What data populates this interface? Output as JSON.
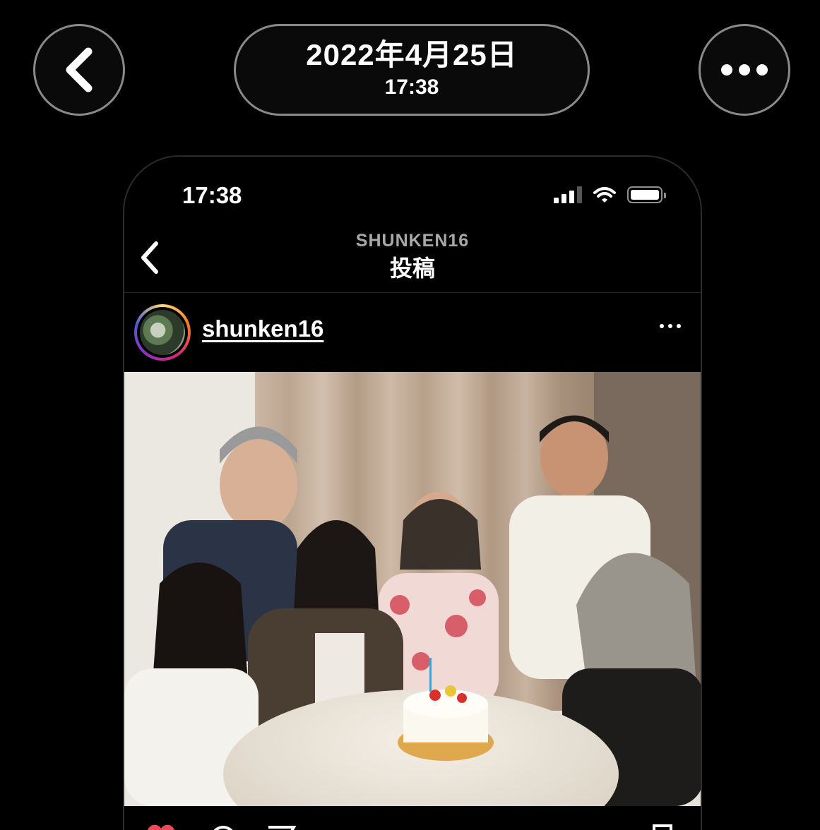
{
  "viewer": {
    "date": "2022年4月25日",
    "time": "17:38"
  },
  "icons": {
    "back": "chevron-left-icon",
    "more": "more-horizontal-icon",
    "signal": "cellular-signal-icon",
    "wifi": "wifi-icon",
    "battery": "battery-icon",
    "like": "heart-icon",
    "comment": "comment-icon",
    "share": "share-icon",
    "save": "bookmark-icon"
  },
  "phone": {
    "status_time": "17:38",
    "battery_level": 1.0,
    "nav": {
      "subtitle": "SHUNKEN16",
      "title": "投稿"
    },
    "post": {
      "username": "shunken16"
    }
  },
  "colors": {
    "background": "#000000",
    "border": "#8a8a8a",
    "like_red": "#ed4956"
  }
}
